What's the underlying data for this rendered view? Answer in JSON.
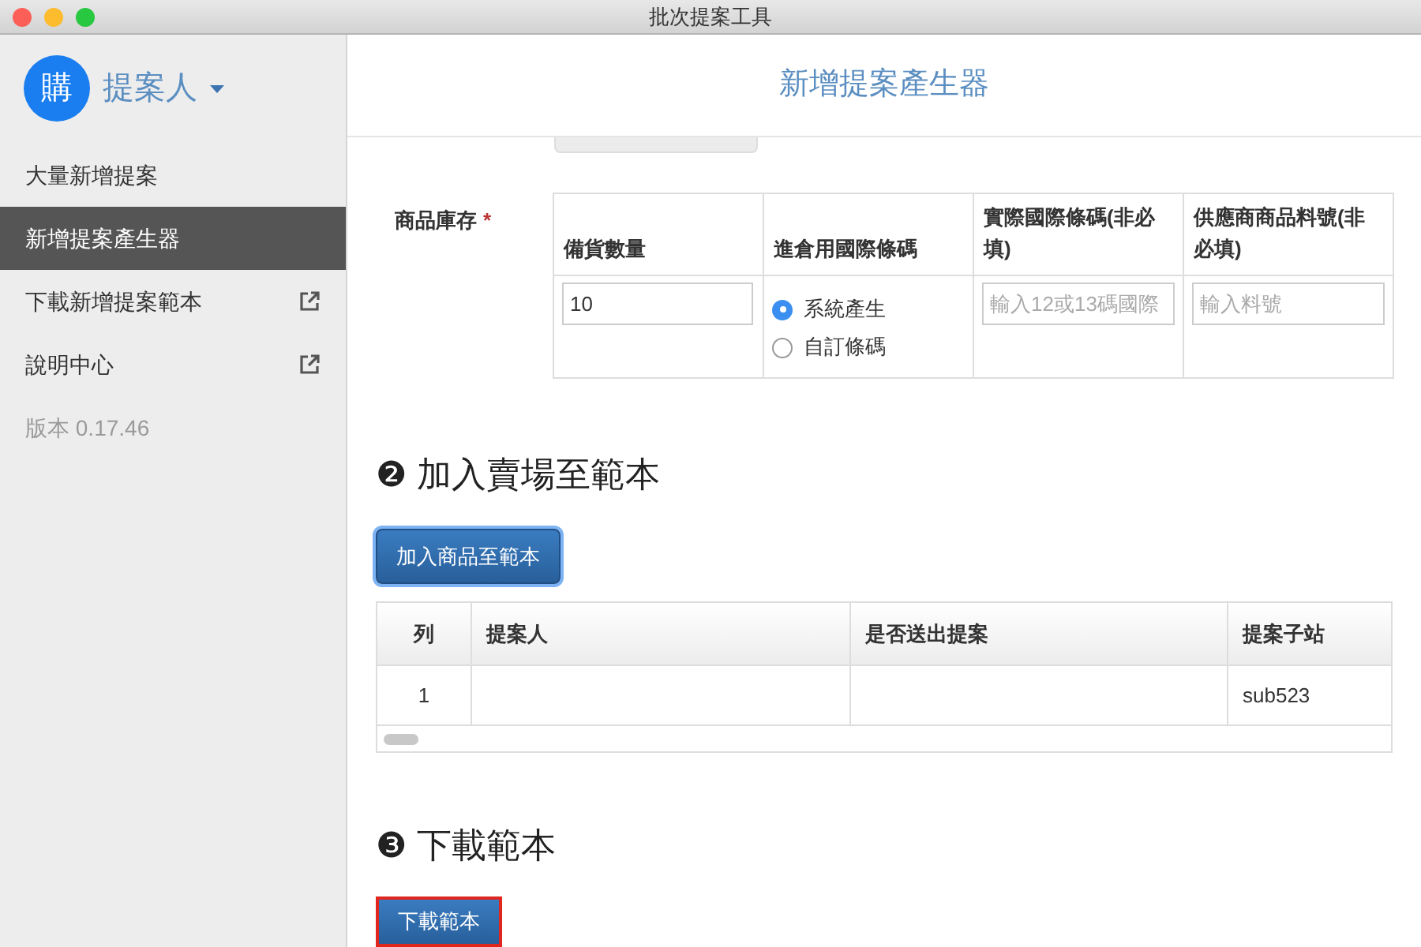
{
  "window": {
    "title": "批次提案工具"
  },
  "sidebar": {
    "avatar": "購",
    "user": "提案人",
    "items": [
      {
        "label": "大量新增提案",
        "selected": false,
        "external": false
      },
      {
        "label": "新增提案產生器",
        "selected": true,
        "external": false
      },
      {
        "label": "下載新增提案範本",
        "selected": false,
        "external": true
      },
      {
        "label": "說明中心",
        "selected": false,
        "external": true
      }
    ],
    "version": "版本 0.17.46"
  },
  "header": {
    "title": "新增提案產生器"
  },
  "inventory": {
    "label": "商品庫存",
    "required_mark": "*",
    "columns": [
      "備貨數量",
      "進倉用國際條碼",
      "實際國際條碼(非必填)",
      "供應商商品料號(非必填)"
    ],
    "quantity": "10",
    "barcode_options": [
      {
        "label": "系統產生",
        "selected": true
      },
      {
        "label": "自訂條碼",
        "selected": false
      }
    ],
    "barcode_placeholder": "輸入12或13碼國際",
    "part_placeholder": "輸入料號"
  },
  "section2": {
    "heading": "❷ 加入賣場至範本",
    "button": "加入商品至範本",
    "table": {
      "columns": [
        "列",
        "提案人",
        "是否送出提案",
        "提案子站"
      ],
      "rows": [
        [
          "1",
          "",
          "",
          "sub523"
        ]
      ]
    }
  },
  "section3": {
    "heading": "❸ 下載範本",
    "button": "下載範本",
    "highlighted": true
  }
}
